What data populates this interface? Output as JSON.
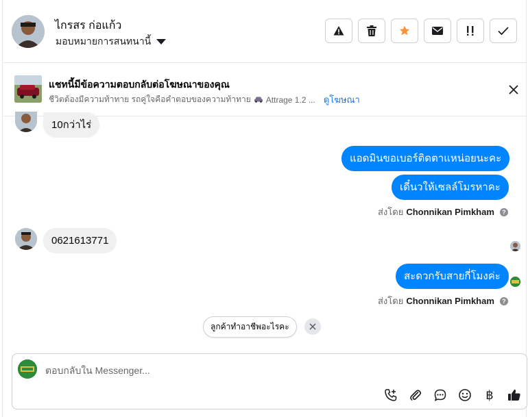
{
  "header": {
    "contact_name": "ไกรสร ก่อแก้ว",
    "assign_label": "มอบหมายการสนทนานี้",
    "actions": [
      {
        "name": "report-spam-button",
        "icon": "warning-icon"
      },
      {
        "name": "delete-button",
        "icon": "trash-icon"
      },
      {
        "name": "star-button",
        "icon": "star-icon"
      },
      {
        "name": "mark-unread-button",
        "icon": "envelope-icon"
      },
      {
        "name": "follow-up-button",
        "icon": "exclamation-icon"
      },
      {
        "name": "mark-done-button",
        "icon": "check-icon"
      }
    ],
    "star_color": "#f7923b"
  },
  "ad": {
    "title": "แชทนี้มีข้อความตอบกลับต่อโฆษณาของคุณ",
    "subtitle": "ชีวิตต้องมีความท้าทาย รถคู่ใจคือคำตอบของความท้าทาย",
    "car_label": "Attrage 1.2 ...",
    "link": "ดูโฆษณา"
  },
  "messages": {
    "m1": "10กว่าไร่",
    "m2": "แอดมินขอเบอร์ติดตาแหน่อยนะคะ",
    "m3": "เดี๋นวให้เซลล์โมรหาคะ",
    "m4": "0621613771",
    "m5": "สะดวกรับสายกี่โมงค่ะ",
    "sent_by_prefix": "ส่งโดย",
    "sent_by_name": "Chonnikan Pimkham",
    "help_glyph": "?"
  },
  "suggestion": {
    "chip": "ลูกค้าทำอาชีพอะไรคะ"
  },
  "composer": {
    "placeholder": "ตอบกลับใน Messenger...",
    "baht_glyph": "฿"
  },
  "colors": {
    "outgoing_bubble": "#0084ff",
    "incoming_bubble": "#f0f0f0",
    "link": "#1877f2"
  }
}
